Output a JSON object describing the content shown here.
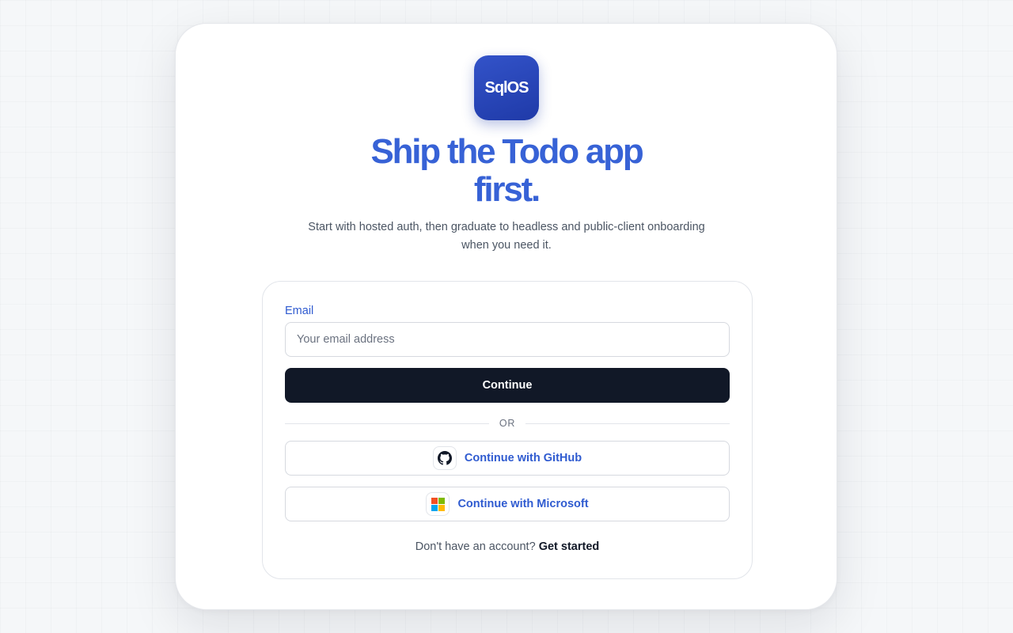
{
  "brand": {
    "logo_text": "SqlOS",
    "accent_color": "#3762d6",
    "logo_color": "#2a47b8"
  },
  "hero": {
    "headline": "Ship the Todo app first.",
    "subtitle": "Start with hosted auth, then graduate to headless and public-client onboarding when you need it."
  },
  "form": {
    "email_label": "Email",
    "email_placeholder": "Your email address",
    "email_value": "",
    "continue_label": "Continue",
    "divider_label": "OR",
    "providers": [
      {
        "label": "Continue with GitHub",
        "icon": "github-icon"
      },
      {
        "label": "Continue with Microsoft",
        "icon": "microsoft-icon"
      }
    ],
    "signup_prompt": "Don't have an account?",
    "signup_link": "Get started"
  }
}
